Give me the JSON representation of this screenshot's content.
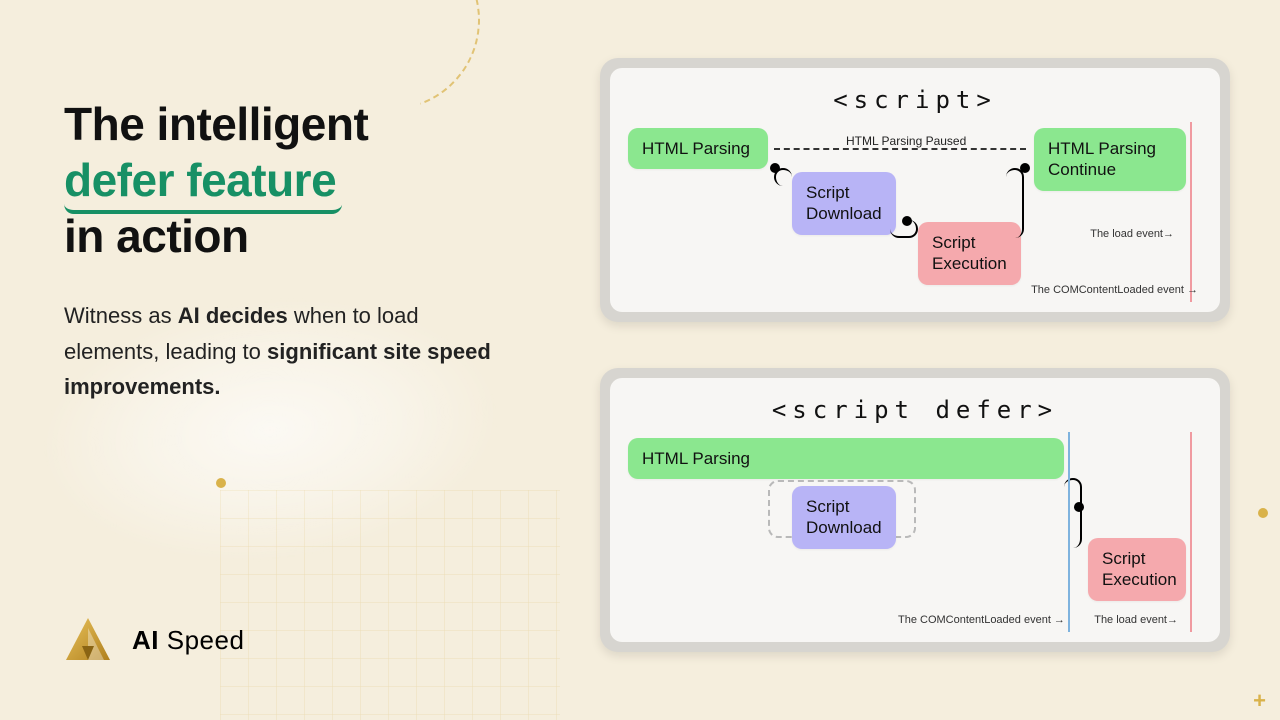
{
  "headline": {
    "line1": "The intelligent",
    "highlight": "defer feature",
    "line3": "in action"
  },
  "subtitle": {
    "pre": "Witness as ",
    "bold1": "AI decides",
    "mid": " when to load elements, leading to ",
    "bold2": "significant site speed improvements."
  },
  "brand": {
    "bold": "AI",
    "rest": " Speed"
  },
  "card1": {
    "title": "<script>",
    "boxes": {
      "html_parsing": "HTML Parsing",
      "script_download": "Script\nDownload",
      "script_execution": "Script\nExecution",
      "html_continue": "HTML Parsing\nContinue"
    },
    "paused_label": "HTML Parsing Paused",
    "event_dom": "The COMContentLoaded event  →",
    "event_load": "The load event→"
  },
  "card2": {
    "title": "<script defer>",
    "boxes": {
      "html_parsing": "HTML Parsing",
      "script_download": "Script\nDownload",
      "script_execution": "Script\nExecution"
    },
    "event_dom": "The COMContentLoaded event  →",
    "event_load": "The load event→"
  }
}
